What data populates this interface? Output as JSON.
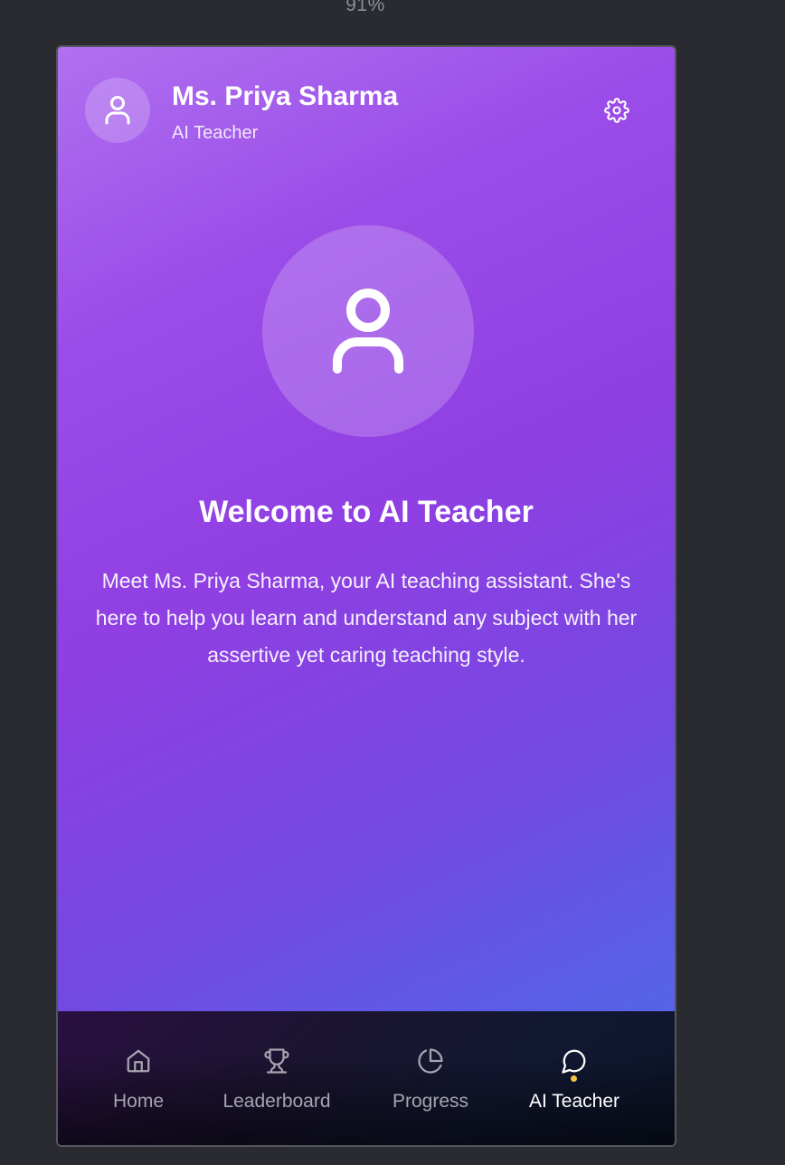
{
  "zoom": "91%",
  "header": {
    "name": "Ms. Priya Sharma",
    "role": "AI Teacher",
    "avatar_icon": "user-icon",
    "settings_icon": "gear-icon"
  },
  "hero": {
    "avatar_icon": "user-icon",
    "title": "Welcome to AI Teacher",
    "description": "Meet Ms. Priya Sharma, your AI teaching assistant. She's here to help you learn and understand any subject with her assertive yet caring teaching style."
  },
  "nav": {
    "items": [
      {
        "label": "Home",
        "icon": "home-icon",
        "active": false
      },
      {
        "label": "Leaderboard",
        "icon": "trophy-icon",
        "active": false
      },
      {
        "label": "Progress",
        "icon": "pie-chart-icon",
        "active": false
      },
      {
        "label": "AI Teacher",
        "icon": "chat-bubble-icon",
        "active": true
      }
    ],
    "active_dot_color": "#f4c542"
  },
  "colors": {
    "gradient_start": "#b070f0",
    "gradient_mid": "#8f3fe2",
    "gradient_end": "#4c6ee6",
    "nav_background": "#121832"
  }
}
